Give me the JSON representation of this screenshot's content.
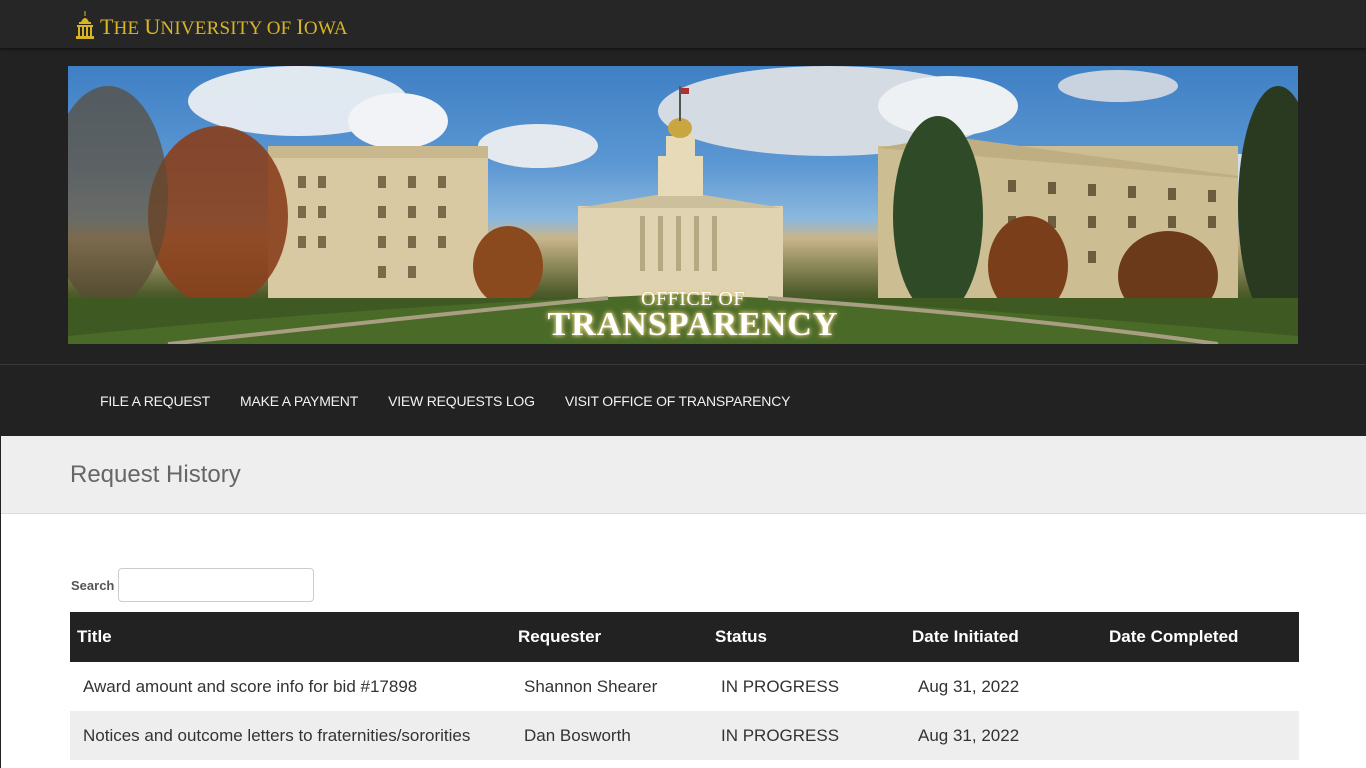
{
  "header": {
    "university_name_parts": [
      "T",
      "HE ",
      "U",
      "NIVERSITY OF ",
      "I",
      "OWA"
    ],
    "university_name": "The University of Iowa",
    "logo_icon": "old-capitol-dome-icon",
    "brand_color": "#d9b526"
  },
  "hero": {
    "title_small": "OFFICE OF",
    "title_large": "TRANSPARENCY"
  },
  "nav": {
    "items": [
      {
        "label": "FILE A REQUEST"
      },
      {
        "label": "MAKE A PAYMENT"
      },
      {
        "label": "VIEW REQUESTS LOG"
      },
      {
        "label": "VISIT OFFICE OF TRANSPARENCY"
      }
    ]
  },
  "page": {
    "title": "Request History"
  },
  "search": {
    "label": "Search",
    "value": "",
    "placeholder": ""
  },
  "table": {
    "columns": [
      "Title",
      "Requester",
      "Status",
      "Date Initiated",
      "Date Completed"
    ],
    "rows": [
      {
        "title": "Award amount and score info for bid #17898",
        "requester": "Shannon Shearer",
        "status": "IN PROGRESS",
        "date_initiated": "Aug 31, 2022",
        "date_completed": ""
      },
      {
        "title": "Notices and outcome letters to fraternities/sororities",
        "requester": "Dan Bosworth",
        "status": "IN PROGRESS",
        "date_initiated": "Aug 31, 2022",
        "date_completed": ""
      }
    ]
  }
}
